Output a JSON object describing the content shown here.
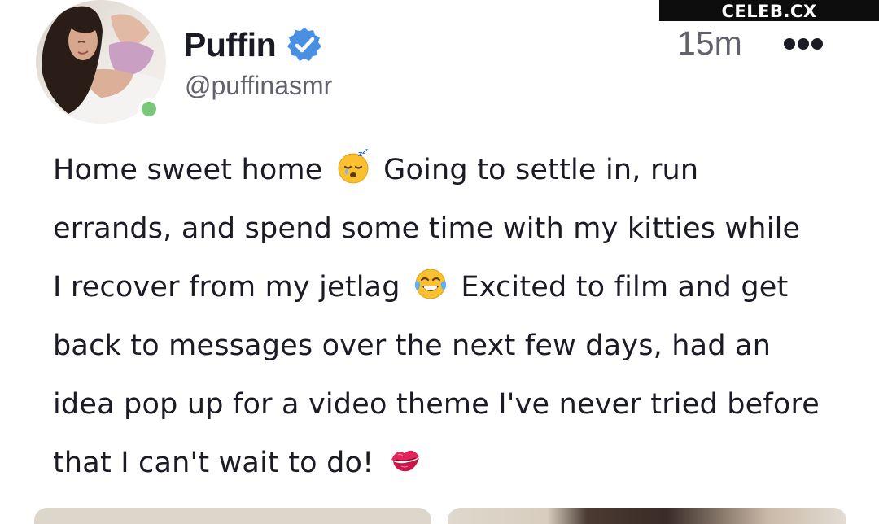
{
  "watermark": "CELEB.CX",
  "post": {
    "author": {
      "display_name": "Puffin",
      "handle": "@puffinasmr",
      "verified": true,
      "online": true
    },
    "timestamp": "15m",
    "lines": [
      {
        "before": "Home sweet home",
        "emoji": "sleeping-face",
        "after": "Going to settle in, run"
      },
      {
        "before": "errands, and spend some time with my kitties while",
        "emoji": null,
        "after": ""
      },
      {
        "before": "I recover from my jetlag",
        "emoji": "tears-of-joy-face",
        "after": "Excited to film and get"
      },
      {
        "before": "back to messages over the next few days, had an",
        "emoji": null,
        "after": ""
      },
      {
        "before": "idea pop up for a video theme I've never tried before",
        "emoji": null,
        "after": ""
      },
      {
        "before": "that I can't wait to do!",
        "emoji": "kiss-mark",
        "after": ""
      }
    ]
  },
  "colors": {
    "verified_blue": "#4a90e2",
    "online_green": "#7ac97b"
  },
  "icons": {
    "verified": "verified-badge-icon",
    "more": "more-options-icon"
  }
}
